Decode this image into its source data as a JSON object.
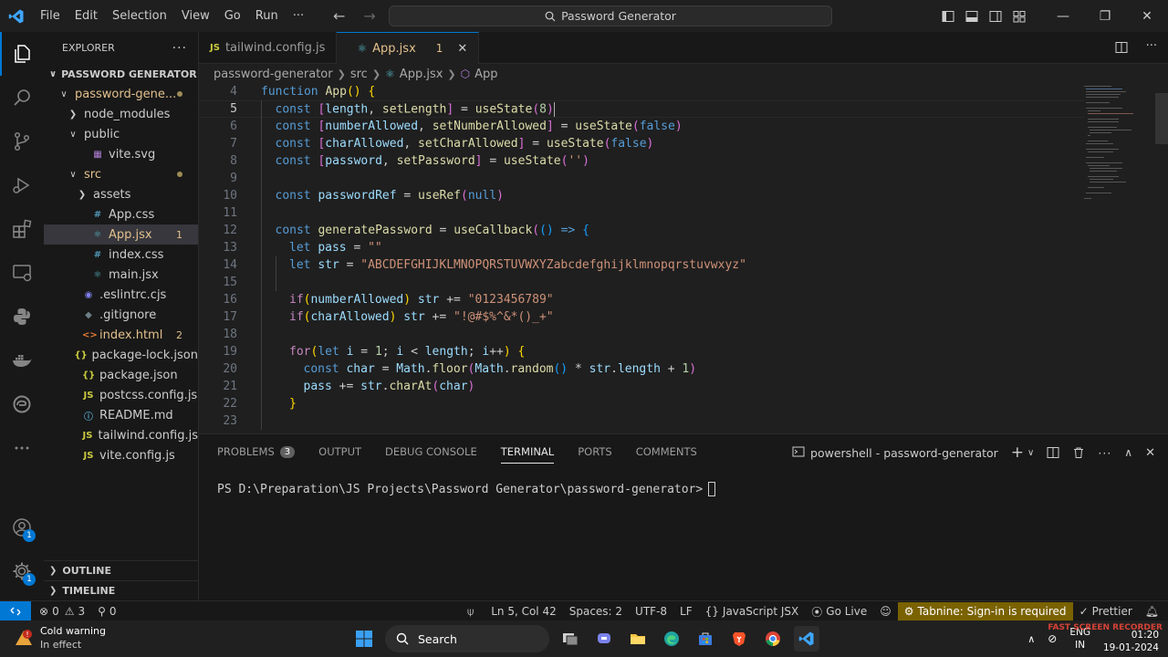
{
  "window": {
    "menu": [
      "File",
      "Edit",
      "Selection",
      "View",
      "Go",
      "Run",
      "···"
    ],
    "command_center": "Password Generator"
  },
  "explorer": {
    "title": "EXPLORER",
    "root": "PASSWORD GENERATOR",
    "tree": [
      {
        "label": "password-gene...",
        "depth": 1,
        "chevron": "v",
        "icon": "",
        "status": "dot",
        "modified": true
      },
      {
        "label": "node_modules",
        "depth": 2,
        "chevron": ">",
        "icon": "",
        "status": "",
        "modified": false
      },
      {
        "label": "public",
        "depth": 2,
        "chevron": "v",
        "icon": "",
        "status": "",
        "modified": false
      },
      {
        "label": "vite.svg",
        "depth": 3,
        "chevron": "",
        "icon": "svg",
        "status": "",
        "modified": false
      },
      {
        "label": "src",
        "depth": 2,
        "chevron": "v",
        "icon": "",
        "status": "dot",
        "modified": true
      },
      {
        "label": "assets",
        "depth": 3,
        "chevron": ">",
        "icon": "",
        "status": "",
        "modified": false
      },
      {
        "label": "App.css",
        "depth": 3,
        "chevron": "",
        "icon": "#",
        "status": "",
        "modified": false
      },
      {
        "label": "App.jsx",
        "depth": 3,
        "chevron": "",
        "icon": "react",
        "status": "1",
        "modified": true,
        "selected": true
      },
      {
        "label": "index.css",
        "depth": 3,
        "chevron": "",
        "icon": "#",
        "status": "",
        "modified": false
      },
      {
        "label": "main.jsx",
        "depth": 3,
        "chevron": "",
        "icon": "react",
        "status": "",
        "modified": false
      },
      {
        "label": ".eslintrc.cjs",
        "depth": 2,
        "chevron": "",
        "icon": "eslint",
        "status": "",
        "modified": false
      },
      {
        "label": ".gitignore",
        "depth": 2,
        "chevron": "",
        "icon": "git",
        "status": "",
        "modified": false
      },
      {
        "label": "index.html",
        "depth": 2,
        "chevron": "",
        "icon": "html",
        "status": "2",
        "modified": true
      },
      {
        "label": "package-lock.json",
        "depth": 2,
        "chevron": "",
        "icon": "{}",
        "status": "",
        "modified": false
      },
      {
        "label": "package.json",
        "depth": 2,
        "chevron": "",
        "icon": "{}",
        "status": "",
        "modified": false
      },
      {
        "label": "postcss.config.js",
        "depth": 2,
        "chevron": "",
        "icon": "JS",
        "status": "",
        "modified": false
      },
      {
        "label": "README.md",
        "depth": 2,
        "chevron": "",
        "icon": "info",
        "status": "",
        "modified": false
      },
      {
        "label": "tailwind.config.js",
        "depth": 2,
        "chevron": "",
        "icon": "JS",
        "status": "",
        "modified": false
      },
      {
        "label": "vite.config.js",
        "depth": 2,
        "chevron": "",
        "icon": "JS",
        "status": "",
        "modified": false
      }
    ],
    "outline": "OUTLINE",
    "timeline": "TIMELINE"
  },
  "tabs": [
    {
      "label": "tailwind.config.js",
      "icon": "JS",
      "active": false
    },
    {
      "label": "App.jsx",
      "icon": "react",
      "active": true,
      "problems": "1"
    }
  ],
  "breadcrumb": [
    "password-generator",
    "src",
    "App.jsx",
    "App"
  ],
  "editor": {
    "current_line": 5,
    "lines": [
      {
        "n": "4",
        "indent": 0,
        "tokens": [
          [
            "kw",
            "function "
          ],
          [
            "fn",
            "App"
          ],
          [
            "br1",
            "() {"
          ]
        ]
      },
      {
        "n": "5",
        "indent": 1,
        "tokens": [
          [
            "kw",
            "const "
          ],
          [
            "br2",
            "["
          ],
          [
            "var",
            "length"
          ],
          [
            "plain",
            ", "
          ],
          [
            "fn",
            "setLength"
          ],
          [
            "br2",
            "]"
          ],
          [
            "plain",
            " = "
          ],
          [
            "fn",
            "useState"
          ],
          [
            "br2",
            "("
          ],
          [
            "num",
            "8"
          ],
          [
            "br2",
            ")"
          ]
        ]
      },
      {
        "n": "6",
        "indent": 1,
        "tokens": [
          [
            "kw",
            "const "
          ],
          [
            "br2",
            "["
          ],
          [
            "var",
            "numberAllowed"
          ],
          [
            "plain",
            ", "
          ],
          [
            "fn",
            "setNumberAllowed"
          ],
          [
            "br2",
            "]"
          ],
          [
            "plain",
            " = "
          ],
          [
            "fn",
            "useState"
          ],
          [
            "br2",
            "("
          ],
          [
            "bool",
            "false"
          ],
          [
            "br2",
            ")"
          ]
        ]
      },
      {
        "n": "7",
        "indent": 1,
        "tokens": [
          [
            "kw",
            "const "
          ],
          [
            "br2",
            "["
          ],
          [
            "var",
            "charAllowed"
          ],
          [
            "plain",
            ", "
          ],
          [
            "fn",
            "setCharAllowed"
          ],
          [
            "br2",
            "]"
          ],
          [
            "plain",
            " = "
          ],
          [
            "fn",
            "useState"
          ],
          [
            "br2",
            "("
          ],
          [
            "bool",
            "false"
          ],
          [
            "br2",
            ")"
          ]
        ]
      },
      {
        "n": "8",
        "indent": 1,
        "tokens": [
          [
            "kw",
            "const "
          ],
          [
            "br2",
            "["
          ],
          [
            "var",
            "password"
          ],
          [
            "plain",
            ", "
          ],
          [
            "fn",
            "setPassword"
          ],
          [
            "br2",
            "]"
          ],
          [
            "plain",
            " = "
          ],
          [
            "fn",
            "useState"
          ],
          [
            "br2",
            "("
          ],
          [
            "str",
            "''"
          ],
          [
            "br2",
            ")"
          ]
        ]
      },
      {
        "n": "9",
        "indent": 0,
        "tokens": []
      },
      {
        "n": "10",
        "indent": 1,
        "tokens": [
          [
            "kw",
            "const "
          ],
          [
            "var",
            "passwordRef"
          ],
          [
            "plain",
            " = "
          ],
          [
            "fn",
            "useRef"
          ],
          [
            "br2",
            "("
          ],
          [
            "bool",
            "null"
          ],
          [
            "br2",
            ")"
          ]
        ]
      },
      {
        "n": "11",
        "indent": 0,
        "tokens": []
      },
      {
        "n": "12",
        "indent": 1,
        "tokens": [
          [
            "kw",
            "const "
          ],
          [
            "fn",
            "generatePassword"
          ],
          [
            "plain",
            " = "
          ],
          [
            "fn",
            "useCallback"
          ],
          [
            "br2",
            "("
          ],
          [
            "br3",
            "()"
          ],
          [
            "plain",
            " "
          ],
          [
            "kw",
            "=>"
          ],
          [
            "plain",
            " "
          ],
          [
            "br3",
            "{"
          ]
        ]
      },
      {
        "n": "13",
        "indent": 2,
        "tokens": [
          [
            "kw",
            "let "
          ],
          [
            "var",
            "pass"
          ],
          [
            "plain",
            " = "
          ],
          [
            "str",
            "\"\""
          ]
        ]
      },
      {
        "n": "14",
        "indent": 2,
        "tokens": [
          [
            "kw",
            "let "
          ],
          [
            "var",
            "str"
          ],
          [
            "plain",
            " = "
          ],
          [
            "str",
            "\"ABCDEFGHIJKLMNOPQRSTUVWXYZabcdefghijklmnopqrstuvwxyz\""
          ]
        ]
      },
      {
        "n": "15",
        "indent": 0,
        "tokens": []
      },
      {
        "n": "16",
        "indent": 2,
        "tokens": [
          [
            "ctl",
            "if"
          ],
          [
            "br1",
            "("
          ],
          [
            "var",
            "numberAllowed"
          ],
          [
            "br1",
            ")"
          ],
          [
            "plain",
            " "
          ],
          [
            "var",
            "str"
          ],
          [
            "plain",
            " += "
          ],
          [
            "str",
            "\"0123456789\""
          ]
        ]
      },
      {
        "n": "17",
        "indent": 2,
        "tokens": [
          [
            "ctl",
            "if"
          ],
          [
            "br1",
            "("
          ],
          [
            "var",
            "charAllowed"
          ],
          [
            "br1",
            ")"
          ],
          [
            "plain",
            " "
          ],
          [
            "var",
            "str"
          ],
          [
            "plain",
            " += "
          ],
          [
            "str",
            "\"!@#$%^&*()_+\""
          ]
        ]
      },
      {
        "n": "18",
        "indent": 0,
        "tokens": []
      },
      {
        "n": "19",
        "indent": 2,
        "tokens": [
          [
            "ctl",
            "for"
          ],
          [
            "br1",
            "("
          ],
          [
            "kw",
            "let "
          ],
          [
            "var",
            "i"
          ],
          [
            "plain",
            " = "
          ],
          [
            "num",
            "1"
          ],
          [
            "plain",
            "; "
          ],
          [
            "var",
            "i"
          ],
          [
            "plain",
            " < "
          ],
          [
            "var",
            "length"
          ],
          [
            "plain",
            "; "
          ],
          [
            "var",
            "i"
          ],
          [
            "plain",
            "++"
          ],
          [
            "br1",
            ")"
          ],
          [
            "plain",
            " "
          ],
          [
            "br1",
            "{"
          ]
        ]
      },
      {
        "n": "20",
        "indent": 3,
        "tokens": [
          [
            "kw",
            "const "
          ],
          [
            "var",
            "char"
          ],
          [
            "plain",
            " = "
          ],
          [
            "var",
            "Math"
          ],
          [
            "plain",
            "."
          ],
          [
            "fn",
            "floor"
          ],
          [
            "br2",
            "("
          ],
          [
            "var",
            "Math"
          ],
          [
            "plain",
            "."
          ],
          [
            "fn",
            "random"
          ],
          [
            "br3",
            "()"
          ],
          [
            "plain",
            " * "
          ],
          [
            "var",
            "str"
          ],
          [
            "plain",
            "."
          ],
          [
            "var",
            "length"
          ],
          [
            "plain",
            " + "
          ],
          [
            "num",
            "1"
          ],
          [
            "br2",
            ")"
          ]
        ]
      },
      {
        "n": "21",
        "indent": 3,
        "tokens": [
          [
            "var",
            "pass"
          ],
          [
            "plain",
            " += "
          ],
          [
            "var",
            "str"
          ],
          [
            "plain",
            "."
          ],
          [
            "fn",
            "charAt"
          ],
          [
            "br2",
            "("
          ],
          [
            "var",
            "char"
          ],
          [
            "br2",
            ")"
          ]
        ]
      },
      {
        "n": "22",
        "indent": 2,
        "tokens": [
          [
            "br1",
            "}"
          ]
        ]
      },
      {
        "n": "23",
        "indent": 0,
        "tokens": []
      }
    ]
  },
  "panel": {
    "tabs": [
      {
        "label": "PROBLEMS",
        "badge": "3",
        "active": false
      },
      {
        "label": "OUTPUT",
        "active": false
      },
      {
        "label": "DEBUG CONSOLE",
        "active": false
      },
      {
        "label": "TERMINAL",
        "active": true
      },
      {
        "label": "PORTS",
        "active": false
      },
      {
        "label": "COMMENTS",
        "active": false
      }
    ],
    "terminal_name": "powershell - password-generator",
    "prompt": "PS D:\\Preparation\\JS Projects\\Password Generator\\password-generator> "
  },
  "status": {
    "errors": "0",
    "warnings": "3",
    "ports": "0",
    "position": "Ln 5, Col 42",
    "spaces": "Spaces: 2",
    "encoding": "UTF-8",
    "eol": "LF",
    "language": "JavaScript JSX",
    "golive": "Go Live",
    "tabnine": "Tabnine: Sign-in is required",
    "prettier": "Prettier"
  },
  "taskbar": {
    "weather_title": "Cold warning",
    "weather_sub": "In effect",
    "search": "Search",
    "lang1": "ENG",
    "lang2": "IN",
    "time": "01:20",
    "date": "19-01-2024",
    "watermark": "FAST SCREEN RECORDER"
  },
  "colors": {
    "accent": "#0078d4",
    "modified": "#e2c08d",
    "tabnine": "#7a6200"
  }
}
